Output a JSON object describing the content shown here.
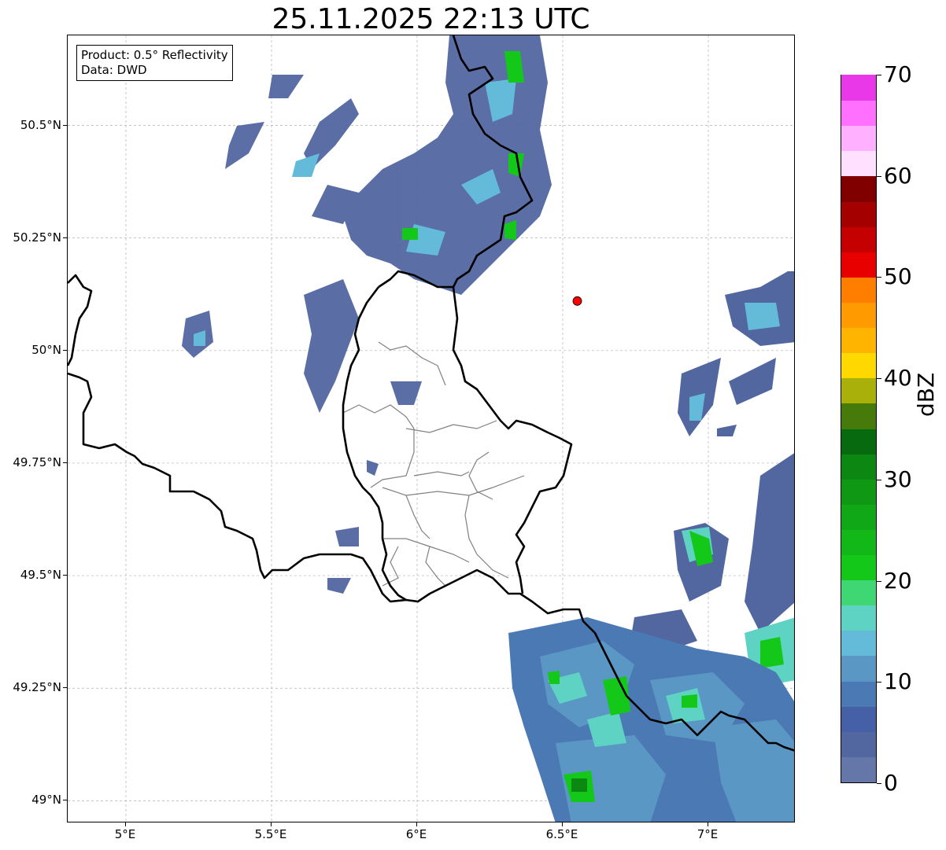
{
  "title": "25.11.2025 22:13 UTC",
  "info_box": {
    "product": "Product: 0.5° Reflectivity",
    "source": "Data: DWD"
  },
  "axes": {
    "lat_labels": [
      "50.5°N",
      "50.25°N",
      "50°N",
      "49.75°N",
      "49.5°N",
      "49.25°N",
      "49°N"
    ],
    "lon_labels": [
      "5°E",
      "5.5°E",
      "6°E",
      "6.5°E",
      "7°E"
    ]
  },
  "extent": {
    "lon_min": 4.8,
    "lon_max": 7.3,
    "lat_min": 48.95,
    "lat_max": 50.7
  },
  "radar_site": {
    "lon": 6.55,
    "lat": 50.11,
    "color": "#ff0000"
  },
  "colorbar": {
    "unit": "dBZ",
    "min": 0,
    "max": 70,
    "tick_labels": [
      "0",
      "10",
      "20",
      "30",
      "40",
      "50",
      "60",
      "70"
    ],
    "colors": [
      "#6576a8",
      "#5266a0",
      "#4560a6",
      "#4a79b4",
      "#5b97c5",
      "#63bbd9",
      "#5ed3c4",
      "#3fd674",
      "#14c81a",
      "#12b818",
      "#10a816",
      "#0e9814",
      "#0b8712",
      "#086a0e",
      "#467a0a",
      "#aab00a",
      "#ffd800",
      "#ffb400",
      "#ff9a00",
      "#ff7e00",
      "#e80000",
      "#c40000",
      "#a40000",
      "#800000",
      "#ffe0ff",
      "#ffb0ff",
      "#ff70ff",
      "#e838e8"
    ]
  },
  "map_colors": {
    "border": "#000000",
    "district": "#808080",
    "grid": "#b0b0b0"
  }
}
